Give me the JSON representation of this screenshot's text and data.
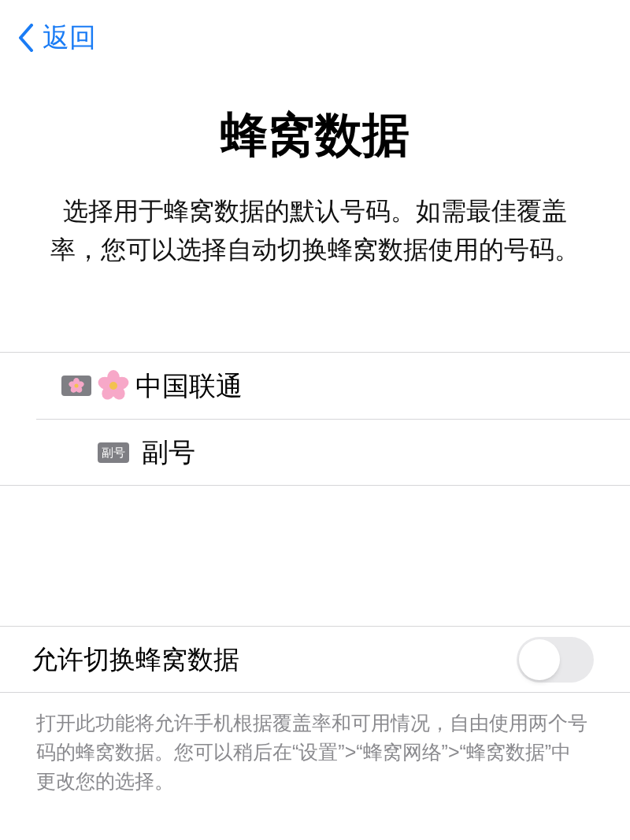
{
  "nav": {
    "back": "返回"
  },
  "title": "蜂窝数据",
  "description": "选择用于蜂窝数据的默认号码。如需最佳覆盖率，您可以选择自动切换蜂窝数据使用的号码。",
  "lines": [
    {
      "kind": "icon",
      "name": "中国联通"
    },
    {
      "kind": "text",
      "badge": "副号",
      "name": "副号"
    }
  ],
  "switch": {
    "label": "允许切换蜂窝数据",
    "on": false
  },
  "footer": "打开此功能将允许手机根据覆盖率和可用情况，自由使用两个号码的蜂窝数据。您可以稍后在“设置”>“蜂窝网络”>“蜂窝数据”中更改您的选择。"
}
